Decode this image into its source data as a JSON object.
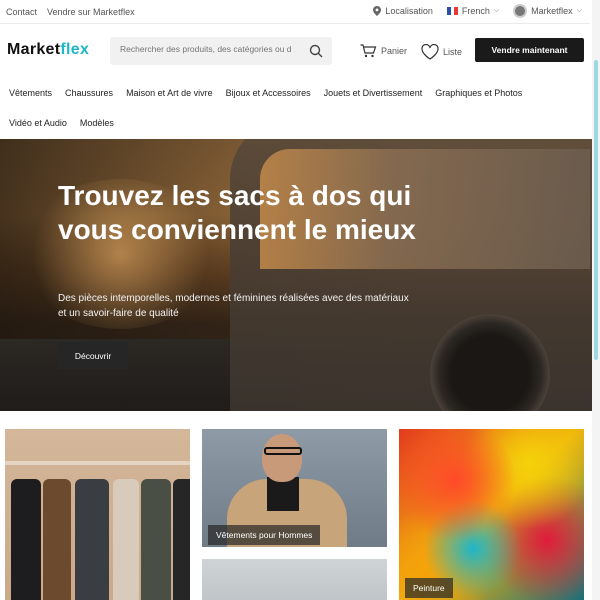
{
  "topbar": {
    "contact": "Contact",
    "sell_on": "Vendre sur Marketflex",
    "location": "Localisation",
    "language": "French",
    "account": "Marketflex"
  },
  "header": {
    "logo_main": "Market",
    "logo_accent": "flex",
    "search_placeholder": "Rechercher des produits, des catégories ou d",
    "cart_label": "Panier",
    "wishlist_label": "Liste",
    "sell_button": "Vendre maintenant"
  },
  "categories": {
    "row1": [
      "Vêtements",
      "Chaussures",
      "Maison et Art de vivre",
      "Bijoux et Accessoires",
      "Jouets et Divertissement",
      "Graphiques et Photos"
    ],
    "row2": [
      "Vidéo et Audio",
      "Modèles"
    ]
  },
  "hero": {
    "title": "Trouvez les sacs à dos qui vous conviennent le mieux",
    "subtitle": "Des pièces intemporelles, modernes et féminines réalisées avec des matériaux et un savoir-faire de qualité",
    "cta": "Découvrir"
  },
  "tiles": {
    "men": "Vêtements pour Hommes",
    "paint": "Peinture"
  },
  "colors": {
    "accent": "#1fb6c9",
    "dark_button": "#1a1a1a"
  }
}
